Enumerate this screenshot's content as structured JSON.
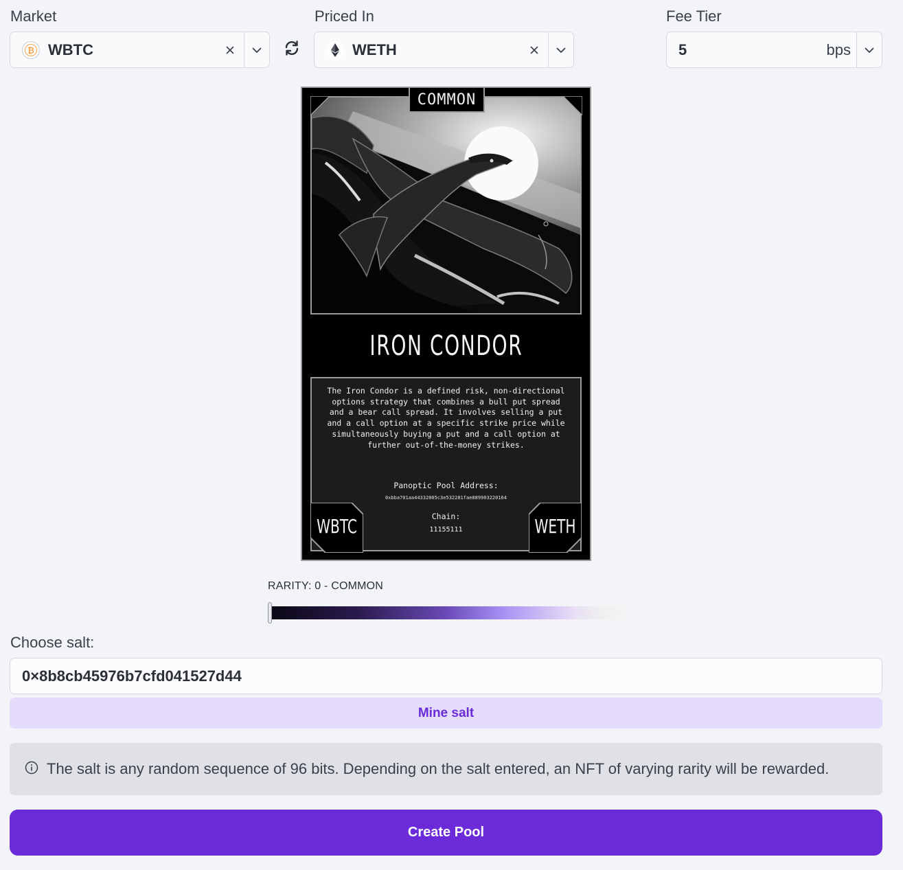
{
  "market": {
    "label": "Market",
    "value": "WBTC",
    "icon": "bitcoin-icon",
    "icon_color": "#f2a24a"
  },
  "priced_in": {
    "label": "Priced In",
    "value": "WETH",
    "icon": "ethereum-icon"
  },
  "fee_tier": {
    "label": "Fee Tier",
    "value": "5",
    "unit": "bps"
  },
  "nft_card": {
    "rarity_tag": "common",
    "title": "IRON CONDOR",
    "description": "The Iron Condor is a defined risk, non-directional options strategy that combines a bull put spread and a bear call spread. It involves selling a put and a call option at a specific strike price while simultaneously buying a put and a call option at further out-of-the-money strikes.",
    "pool_address_label": "Panoptic Pool Address:",
    "pool_address": "0xbba701aa44332005c3e532281fae889903220164",
    "chain_label": "Chain:",
    "chain_id": "11155111",
    "left_corner": "WBTC",
    "right_corner": "WETH"
  },
  "rarity": {
    "label": "RARITY: 0 - COMMON",
    "level": 0
  },
  "salt": {
    "label": "Choose salt:",
    "value": "0×8b8cb45976b7cfd041527d44",
    "mine_button": "Mine salt"
  },
  "info": {
    "text": "The salt is any random sequence of 96 bits. Depending on the salt entered, an NFT of varying rarity will be rewarded."
  },
  "create_button": "Create Pool",
  "colors": {
    "accent": "#6b2bd9",
    "accent_light": "#e4dcfa",
    "background": "#f3f4f8"
  }
}
